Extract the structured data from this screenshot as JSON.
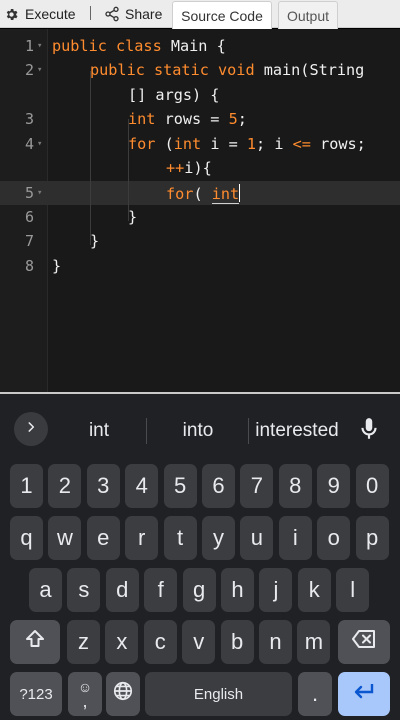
{
  "toolbar": {
    "execute_label": "Execute",
    "separator": "|",
    "share_label": "Share",
    "tabs": [
      {
        "label": "Source Code",
        "active": true
      },
      {
        "label": "Output",
        "active": false
      }
    ]
  },
  "editor": {
    "current_line": 5,
    "lines": [
      {
        "number": "1",
        "fold": true
      },
      {
        "number": "2",
        "fold": true
      },
      {
        "number": "3",
        "fold": false
      },
      {
        "number": "4",
        "fold": true
      },
      {
        "number": "5",
        "fold": true
      },
      {
        "number": "6",
        "fold": false
      },
      {
        "number": "7",
        "fold": false
      },
      {
        "number": "8",
        "fold": false
      }
    ],
    "code": {
      "l1": {
        "kw": "public class",
        "rest": " Main {"
      },
      "l2": {
        "kw": "public static void",
        "rest": " main(String"
      },
      "l2b": {
        "rest": "[] args) {"
      },
      "l3": {
        "kw": "int",
        "rest": " rows = ",
        "num": "5",
        "end": ";"
      },
      "l4": {
        "kw": "for",
        "a": " (",
        "kw2": "int",
        "b": " i = ",
        "num": "1",
        "c": "; i ",
        "op": "<=",
        "d": " rows;"
      },
      "l4b": {
        "op": "++",
        "rest": "i){"
      },
      "l5": {
        "kw": "for",
        "a": "( ",
        "typed": "int"
      },
      "l6": "}",
      "l7": "}",
      "l8": "}"
    }
  },
  "keyboard": {
    "suggestions": [
      "int",
      "into",
      "interested"
    ],
    "row1": [
      "1",
      "2",
      "3",
      "4",
      "5",
      "6",
      "7",
      "8",
      "9",
      "0"
    ],
    "row2": [
      "q",
      "w",
      "e",
      "r",
      "t",
      "y",
      "u",
      "i",
      "o",
      "p"
    ],
    "row3": [
      "a",
      "s",
      "d",
      "f",
      "g",
      "h",
      "j",
      "k",
      "l"
    ],
    "row4": [
      "z",
      "x",
      "c",
      "v",
      "b",
      "n",
      "m"
    ],
    "symbols_label": "?123",
    "emoji_label": "☺",
    "comma_label": ",",
    "space_label": "English",
    "period_label": "."
  },
  "colors": {
    "keyword": "#ff8c2e",
    "editor_bg": "#191919",
    "keyboard_bg": "#202124",
    "key_bg": "#3c3d41",
    "enter_bg": "#a8c7fa"
  },
  "icons": {
    "execute": "gear-icon",
    "share": "share-icon",
    "suggestions_expand": "chevron-right-icon",
    "mic": "microphone-icon",
    "shift": "shift-arrow-icon",
    "backspace": "backspace-icon",
    "language": "globe-icon",
    "enter": "enter-arrow-icon"
  }
}
